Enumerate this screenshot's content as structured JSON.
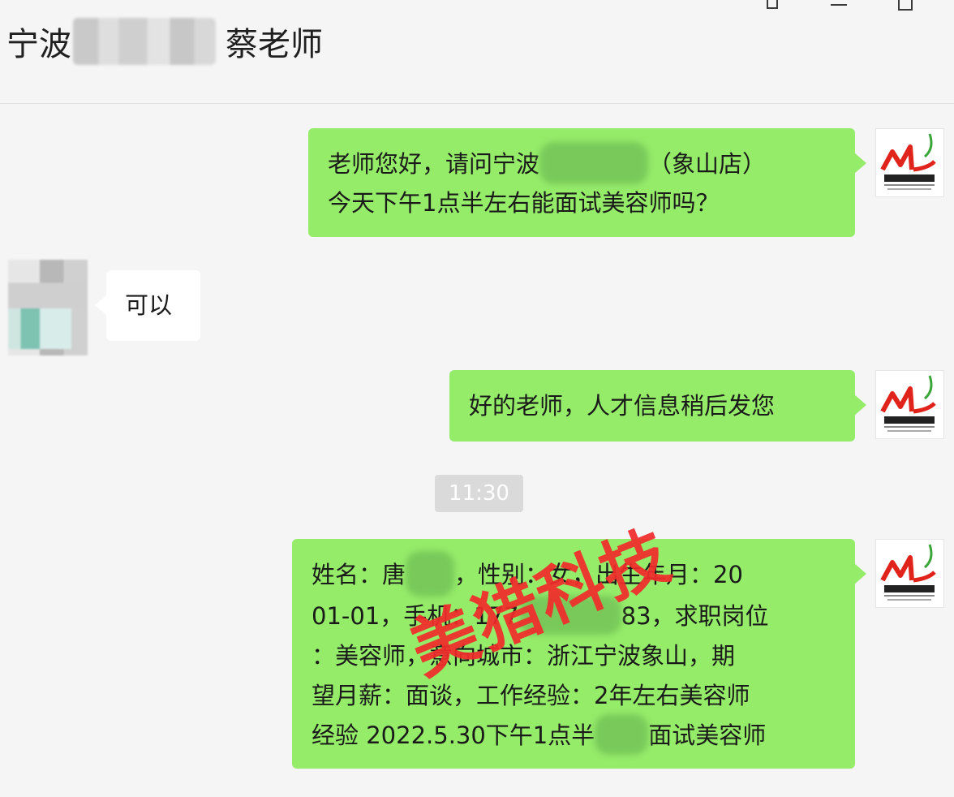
{
  "header": {
    "title_prefix": "宁波",
    "title_suffix": "蔡老师"
  },
  "messages": [
    {
      "side": "right",
      "lines": [
        {
          "a": "老师您好，请问宁波",
          "b": "（象山店）"
        },
        {
          "a": "今天下午1点半左右能面试美容师吗？"
        }
      ]
    },
    {
      "side": "left",
      "lines": [
        {
          "a": "可以"
        }
      ]
    },
    {
      "side": "right",
      "lines": [
        {
          "a": "好的老师，人才信息稍后发您"
        }
      ]
    },
    {
      "side": "right",
      "lines": [
        {
          "a": "姓名：唐",
          "b": "，性别：女，出生年月：20"
        },
        {
          "a": "01-01，手机：177",
          "b": "83，求职岗位"
        },
        {
          "a": "：美容师，意向城市：浙江宁波象山，期"
        },
        {
          "a": "望月薪：面谈，工作经验：2年左右美容师"
        },
        {
          "a": "经验 2022.5.30下午1点半",
          "b": "面试美容师"
        }
      ]
    }
  ],
  "timestamp": "11:30",
  "watermark": "美猎科技",
  "avatar_logo": "ML",
  "colors": {
    "bubble_sent": "#95ec69",
    "bubble_received": "#ffffff",
    "background": "#f5f5f5",
    "watermark": "#f22b2b"
  }
}
